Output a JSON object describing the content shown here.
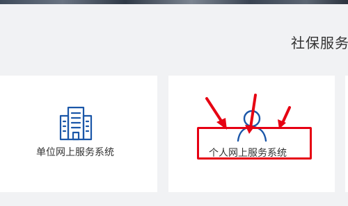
{
  "section": {
    "title": "社保服务"
  },
  "cards": [
    {
      "label": "单位网上服务系统",
      "icon": "building-icon"
    },
    {
      "label": "个人网上服务系统",
      "icon": "person-icon"
    }
  ],
  "colors": {
    "icon_blue": "#1a56a8",
    "annotation_red": "#e60012",
    "background": "#f1f2f4",
    "card": "#ffffff"
  },
  "annotation": {
    "type": "red-box-and-arrows",
    "target": "个人网上服务系统",
    "arrow_count": 3
  }
}
